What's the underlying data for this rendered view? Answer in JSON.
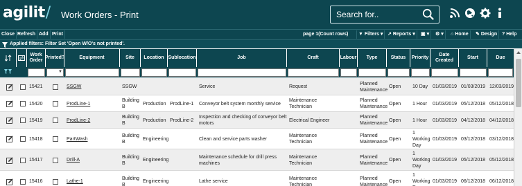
{
  "app": {
    "logo": "agilit",
    "title": "Work Orders - Print"
  },
  "search": {
    "placeholder": "Search for.."
  },
  "toolbar": {
    "buttons": [
      "Close",
      "Refresh",
      "Add",
      "Print"
    ],
    "page_info": "page 1(Count rows)",
    "right_buttons": [
      "Filters",
      "Reports",
      "",
      "",
      "Home",
      "Design",
      "Help"
    ]
  },
  "filter": {
    "text": "Applied filters: Filter Set 'Open W/O's not printed'."
  },
  "table": {
    "headers": [
      "Work Order",
      "Printed?",
      "Equipment",
      "Site",
      "Location",
      "Sublocation",
      "Job",
      "Craft",
      "Labour",
      "Type",
      "Status",
      "Priority",
      "Date Created",
      "Start",
      "Due"
    ],
    "rows": [
      {
        "wo": "15421",
        "equipment": "SSGW",
        "site": "SSGW",
        "location": "",
        "sublocation": "",
        "job": "Service",
        "craft": "Request",
        "labour": "",
        "type": "Planned Maintenance",
        "status": "Open",
        "priority": "10 Day",
        "created": "01/03/2019",
        "start": "01/03/2019",
        "due": "12/03/2019"
      },
      {
        "wo": "15420",
        "equipment": "ProdLine-1",
        "site": "Building B",
        "location": "Production",
        "sublocation": "ProdLine-1",
        "job": "Conveyor belt system monthly service",
        "craft": "Maintenance Technician",
        "labour": "",
        "type": "Planned Maintenance",
        "status": "Open",
        "priority": "1 Hour",
        "created": "01/03/2019",
        "start": "05/12/2018",
        "due": "05/12/2018"
      },
      {
        "wo": "15419",
        "equipment": "ProdLine-2",
        "site": "Building B",
        "location": "Production",
        "sublocation": "ProdLine-2",
        "job": "Inspection and checking of conveyor belt motors",
        "craft": "Electrical Engineer",
        "labour": "",
        "type": "Planned Maintenance",
        "status": "Open",
        "priority": "1 Hour",
        "created": "01/03/2019",
        "start": "04/12/2018",
        "due": "04/12/2018"
      },
      {
        "wo": "15418",
        "equipment": "PartWash",
        "site": "Building B",
        "location": "Engineering",
        "sublocation": "",
        "job": "Clean and service parts washer",
        "craft": "Maintenance Technician",
        "labour": "",
        "type": "Planned Maintenance",
        "status": "Open",
        "priority": "1 Working Day",
        "created": "01/03/2019",
        "start": "03/12/2018",
        "due": "03/12/2018"
      },
      {
        "wo": "15417",
        "equipment": "Drill-A",
        "site": "Building B",
        "location": "Engineering",
        "sublocation": "",
        "job": "Maintenance schedule for drill press machines",
        "craft": "Maintenance Technician",
        "labour": "",
        "type": "Planned Maintenance",
        "status": "Open",
        "priority": "1 Working Day",
        "created": "01/03/2019",
        "start": "05/12/2018",
        "due": "05/12/2018"
      },
      {
        "wo": "15416",
        "equipment": "Lathe-1",
        "site": "Building B",
        "location": "Engineering",
        "sublocation": "",
        "job": "Lathe service",
        "craft": "Maintenance Technician",
        "labour": "",
        "type": "Planned Maintenance",
        "status": "Open",
        "priority": "1 Working Day",
        "created": "01/03/2019",
        "start": "06/12/2018",
        "due": "06/12/2018"
      }
    ]
  },
  "colors": {
    "header_bg": "#0d4650",
    "row_alt": "#eeeeee",
    "text": "#222222"
  }
}
